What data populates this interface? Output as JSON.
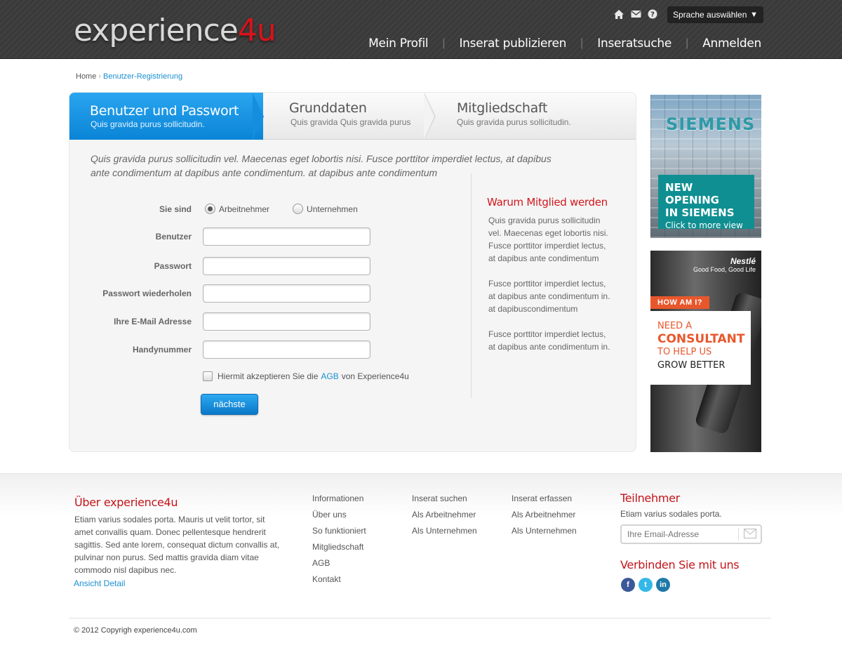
{
  "header": {
    "logo_main": "experience",
    "logo_accent": "4u",
    "language_select": "Sprache auswählen",
    "icons": [
      "home-icon",
      "mail-icon",
      "help-icon"
    ],
    "nav": [
      "Mein Profil",
      "Inserat publizieren",
      "Inseratsuche",
      "Anmelden"
    ],
    "nav_separator": "|"
  },
  "breadcrumb": {
    "home": "Home",
    "separator": "›",
    "current": "Benutzer-Registrierung"
  },
  "steps": [
    {
      "title": "Benutzer und Passwort",
      "subtitle": "Quis gravida purus sollicitudin.",
      "active": true
    },
    {
      "title": "Grunddaten",
      "subtitle": "Quis gravida Quis gravida purus",
      "active": false
    },
    {
      "title": "Mitgliedschaft",
      "subtitle": "Quis gravida purus sollicitudin.",
      "active": false
    }
  ],
  "intro": "Quis gravida purus sollicitudin vel. Maecenas eget lobortis nisi. Fusce porttitor imperdiet lectus, at dapibus ante condimentum at dapibus ante condimentum. at dapibus ante condimentum",
  "form": {
    "type_label": "Sie sind",
    "options": [
      "Arbeitnehmer",
      "Unternehmen"
    ],
    "selected_option": "Arbeitnehmer",
    "fields": [
      {
        "label": "Benutzer",
        "value": ""
      },
      {
        "label": "Passwort",
        "value": ""
      },
      {
        "label": "Passwort wiederholen",
        "value": ""
      },
      {
        "label": "Ihre E-Mail Adresse",
        "value": ""
      },
      {
        "label": "Handynummer",
        "value": ""
      }
    ],
    "agb_prefix": "Hiermit akzeptieren Sie die",
    "agb_link": "AGB",
    "agb_suffix": "von Experience4u",
    "agb_checked": false,
    "next_button": "nächste"
  },
  "why": {
    "title": "Warum Mitglied werden",
    "paragraphs": [
      "Quis gravida purus sollicitudin vel. Maecenas eget lobortis nisi. Fusce porttitor imperdiet lectus, at dapibus ante condimentum",
      "Fusce porttitor imperdiet lectus, at dapibus ante condimentum in. at dapibuscondimentum",
      "Fusce porttitor imperdiet lectus, at dapibus ante condimentum in."
    ]
  },
  "ads": {
    "siemens": {
      "brand": "SIEMENS",
      "headline_1": "NEW OPENING",
      "headline_2": "IN SIEMENS",
      "cta": "Click to more view"
    },
    "nestle": {
      "brand": "Nestlé",
      "tagline": "Good Food, Good Life",
      "tag": "HOW AM I?",
      "line_1": "NEED A",
      "line_2": "CONSULTANT",
      "line_3": "TO HELP US",
      "line_4": "GROW BETTER"
    }
  },
  "footer": {
    "about_title": "Über experience4u",
    "about_text": "Etiam varius sodales porta. Mauris ut velit tortor, sit amet convallis quam. Donec pellentesque hendrerit sagittis. Sed ante lorem, consequat dictum convallis at, pulvinar non purus. Sed mattis gravida diam vitae commodo nisl dapibus nec.",
    "about_more": "Ansicht Detail",
    "col1": [
      "Informationen",
      "Über uns",
      "So funktioniert",
      "Mitgliedschaft",
      "AGB",
      "Kontakt"
    ],
    "col2": [
      "Inserat suchen",
      "Als Arbeitnehmer",
      "Als Unternehmen"
    ],
    "col3": [
      "Inserat erfassen",
      "Als Arbeitnehmer",
      "Als Unternehmen"
    ],
    "participant_title": "Teilnehmer",
    "participant_text": "Etiam varius sodales porta.",
    "email_placeholder": "Ihre Email-Adresse",
    "connect_title": "Verbinden Sie mit uns",
    "social": [
      "facebook-icon",
      "twitter-icon",
      "linkedin-icon"
    ],
    "copyright": "© 2012 Copyrigh experience4u.com"
  },
  "colors": {
    "brand_red": "#d8131a",
    "link_blue": "#1a8fd1",
    "step_active": "#148fdf",
    "header_bg": "#3a3a3a"
  }
}
